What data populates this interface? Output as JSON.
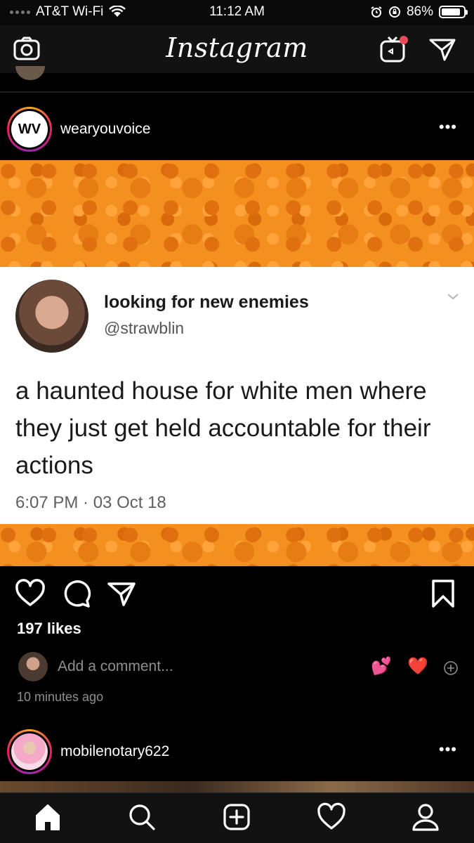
{
  "status_bar": {
    "carrier": "AT&T Wi-Fi",
    "time": "11:12 AM",
    "battery": "86%",
    "battery_level": 0.86
  },
  "header": {
    "logo": "Instagram",
    "icons": [
      "camera-icon",
      "igtv-icon",
      "direct-message-icon"
    ]
  },
  "post": {
    "username": "wearyouvoice",
    "avatar_text": "WV",
    "tweet": {
      "display_name": "looking for new enemies",
      "handle": "@strawblin",
      "text": "a haunted house for white men where they just get held accountable for their actions",
      "timestamp": "6:07 PM · 03 Oct 18"
    },
    "likes": "197 likes",
    "comment_placeholder": "Add a comment...",
    "quick_emojis": [
      "💕",
      "❤️"
    ],
    "time_ago": "10 minutes ago"
  },
  "next_post": {
    "username": "mobilenotary622"
  },
  "tab_bar": {
    "items": [
      "home-icon",
      "search-icon",
      "new-post-icon",
      "activity-heart-icon",
      "profile-icon"
    ]
  },
  "colors": {
    "background": "#000000",
    "bar": "#121212",
    "pattern_orange": "#f3901f",
    "muted_text": "#8e8e8e",
    "notification_dot": "#ed4956"
  }
}
